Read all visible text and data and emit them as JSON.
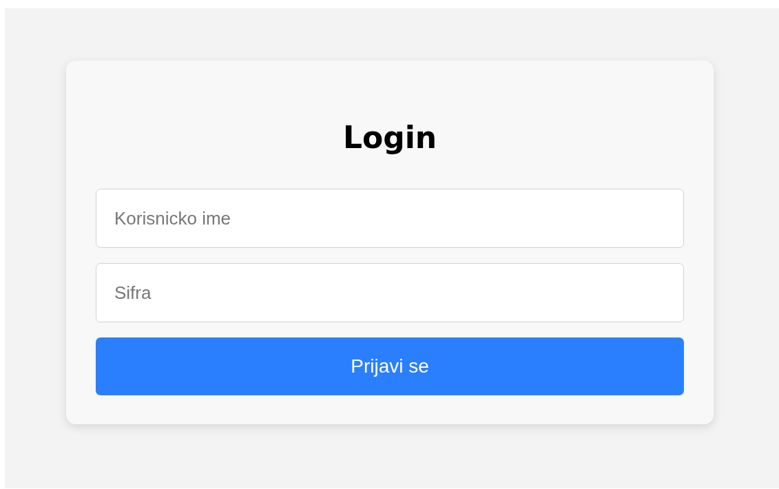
{
  "login_form": {
    "title": "Login",
    "fields": [
      {
        "placeholder": "Korisnicko ime"
      },
      {
        "placeholder": "Sifra"
      }
    ],
    "submit_button": "Prijavi se"
  }
}
